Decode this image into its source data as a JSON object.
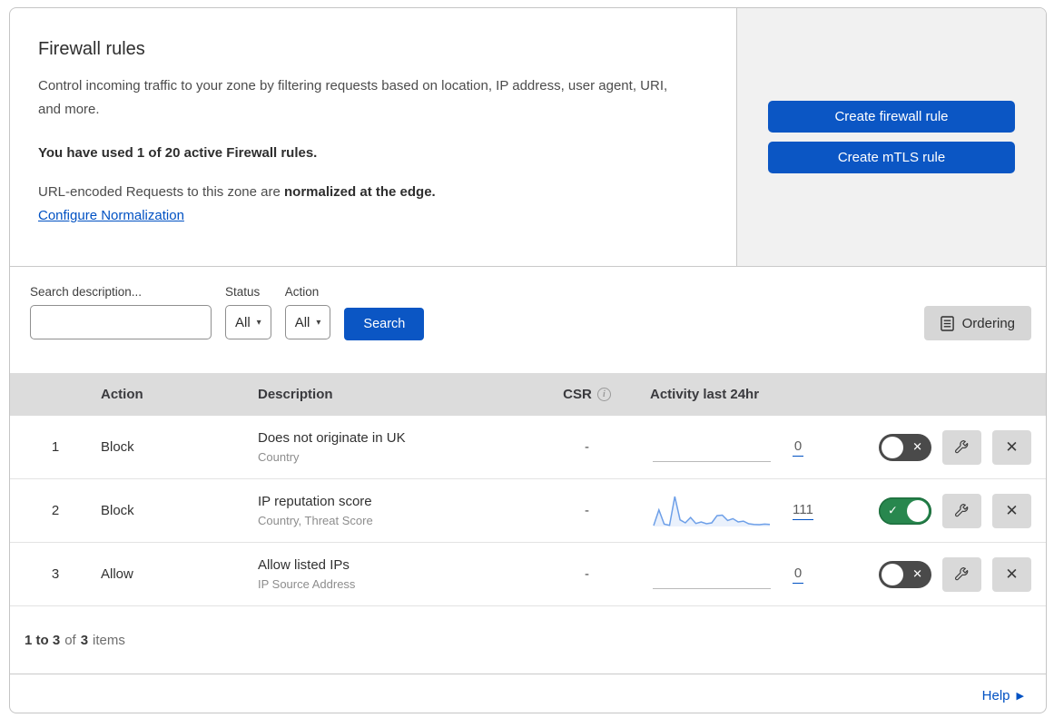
{
  "header": {
    "title": "Firewall rules",
    "description": "Control incoming traffic to your zone by filtering requests based on location, IP address, user agent, URI, and more.",
    "usage_line": "You have used 1 of 20 active Firewall rules.",
    "normalization_text": "URL-encoded Requests to this zone are",
    "normalization_bold": "normalized at the edge.",
    "normalization_link": "Configure Normalization",
    "create_firewall_button": "Create firewall rule",
    "create_mtls_button": "Create mTLS rule"
  },
  "filters": {
    "search_label": "Search description...",
    "search_value": "",
    "status_label": "Status",
    "status_value": "All",
    "action_label": "Action",
    "action_value": "All",
    "search_button": "Search",
    "ordering_button": "Ordering"
  },
  "table": {
    "columns": {
      "action": "Action",
      "description": "Description",
      "csr": "CSR",
      "activity": "Activity last 24hr"
    },
    "rows": [
      {
        "num": "1",
        "action": "Block",
        "title": "Does not originate in UK",
        "subtitle": "Country",
        "csr": "-",
        "count": "0",
        "enabled": false,
        "sparkline": []
      },
      {
        "num": "2",
        "action": "Block",
        "title": "IP reputation score",
        "subtitle": "Country, Threat Score",
        "csr": "-",
        "count": "111",
        "enabled": true,
        "sparkline": [
          3,
          55,
          8,
          4,
          100,
          22,
          12,
          30,
          10,
          15,
          9,
          12,
          36,
          38,
          20,
          26,
          15,
          18,
          9,
          7,
          6,
          8,
          7
        ]
      },
      {
        "num": "3",
        "action": "Allow",
        "title": "Allow listed IPs",
        "subtitle": "IP Source Address",
        "csr": "-",
        "count": "0",
        "enabled": false,
        "sparkline": []
      }
    ]
  },
  "footer": {
    "summary_range": "1 to 3",
    "summary_of": "of",
    "summary_total": "3",
    "summary_items": "items",
    "help_label": "Help"
  },
  "colors": {
    "accent_blue": "#0b56c4",
    "link_blue": "#0051c3",
    "toggle_on_green": "#28874e",
    "toggle_off_gray": "#4a4a4a",
    "sparkline_blue": "#6d9fe8",
    "table_header_gray": "#dcdcdc",
    "panel_gray": "#f1f1f1"
  }
}
